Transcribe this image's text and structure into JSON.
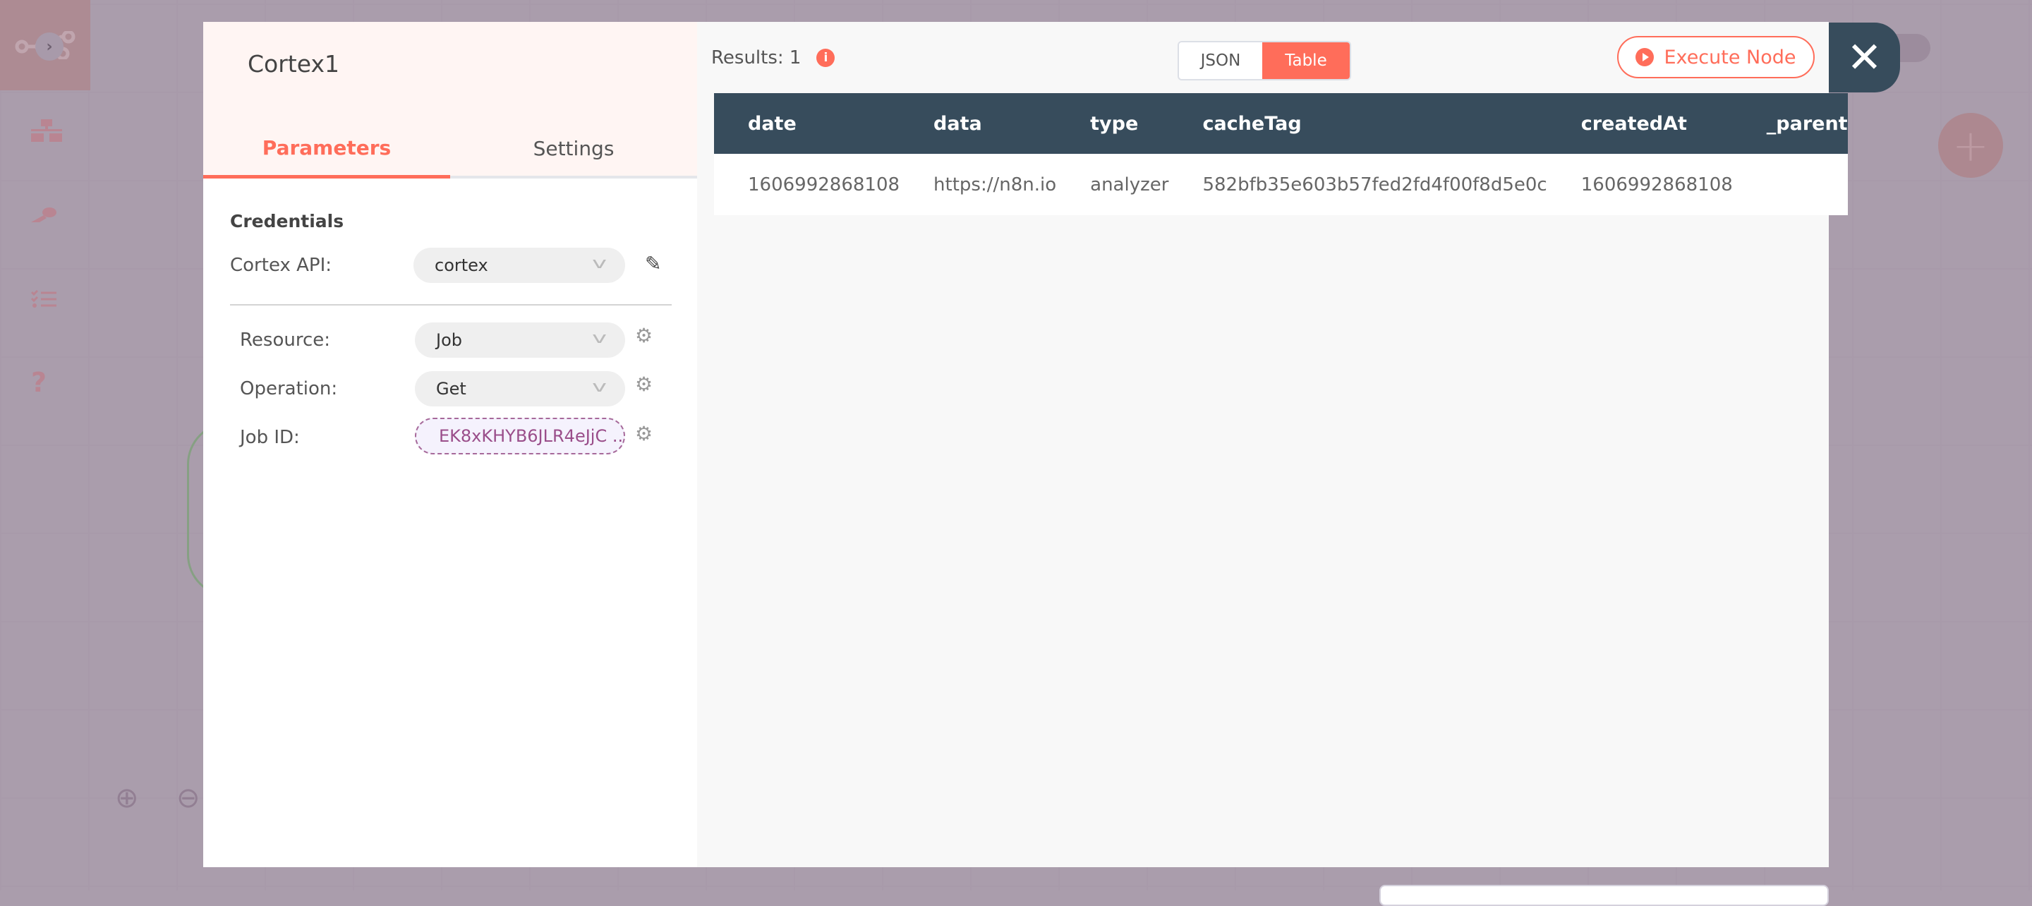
{
  "sidebar": {
    "items": [
      {
        "icon": "network-icon"
      },
      {
        "icon": "key-icon"
      },
      {
        "icon": "checklist-icon"
      },
      {
        "icon": "help-icon"
      }
    ]
  },
  "node": {
    "title": "Cortex1"
  },
  "tabs": [
    {
      "label": "Parameters",
      "active": true
    },
    {
      "label": "Settings",
      "active": false
    }
  ],
  "params": {
    "credentials_heading": "Credentials",
    "cortex_api_label": "Cortex API:",
    "cortex_api_value": "cortex",
    "resource_label": "Resource:",
    "resource_value": "Job",
    "operation_label": "Operation:",
    "operation_value": "Get",
    "job_id_label": "Job ID:",
    "job_id_value": "EK8xKHYB6JLR4eJjC ..."
  },
  "output": {
    "results_label": "Results: 1",
    "view_json": "JSON",
    "view_table": "Table",
    "active_view": "Table",
    "execute_label": "Execute Node",
    "columns": [
      "date",
      "data",
      "type",
      "cacheTag",
      "createdAt",
      "_parent"
    ],
    "rows": [
      [
        "1606992868108",
        "https://n8n.io",
        "analyzer",
        "582bfb35e603b57fed2fd4f00f8d5e0c",
        "1606992868108",
        ""
      ]
    ]
  },
  "colors": {
    "accent": "#ff6d5a",
    "header": "#374c5c",
    "expression": "#9a4e8a"
  }
}
